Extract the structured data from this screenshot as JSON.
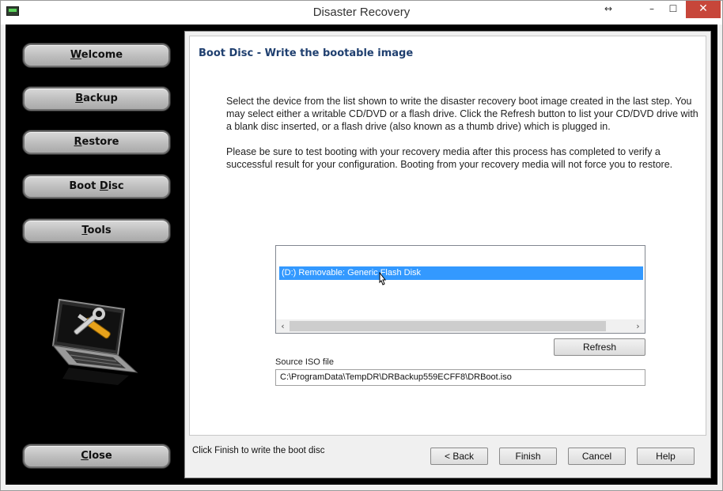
{
  "window": {
    "title": "Disaster Recovery",
    "controls": {
      "resize": "↔",
      "minimize": "–",
      "maximize": "☐",
      "close": "✕"
    }
  },
  "sidebar": {
    "items": [
      {
        "pre": "",
        "accel": "W",
        "post": "elcome"
      },
      {
        "pre": "",
        "accel": "B",
        "post": "ackup"
      },
      {
        "pre": "",
        "accel": "R",
        "post": "estore"
      },
      {
        "pre": "Boot ",
        "accel": "D",
        "post": "isc"
      },
      {
        "pre": "",
        "accel": "T",
        "post": "ools"
      }
    ],
    "close": {
      "pre": "",
      "accel": "C",
      "post": "lose"
    }
  },
  "page": {
    "title": "Boot Disc - Write the bootable image",
    "desc1": "Select the device from the list shown to write the disaster recovery boot image created in the last step. You may select either a writable CD/DVD or a flash drive. Click the Refresh button to list your CD/DVD drive with a blank disc inserted, or a flash drive (also known as a thumb drive) which is plugged in.",
    "desc2": "Please be sure to test booting with your recovery media after this process has completed to verify a successful result for your configuration. Booting from your recovery media will not force you to restore."
  },
  "devices": {
    "items": [
      "(D:) Removable: Generic Flash Disk"
    ],
    "selected_index": 0,
    "scroll_left": "‹",
    "scroll_right": "›"
  },
  "refresh_label": "Refresh",
  "iso": {
    "label": "Source ISO file",
    "value": "C:\\ProgramData\\TempDR\\DRBackup559ECFF8\\DRBoot.iso"
  },
  "footer": {
    "status": "Click Finish to write the boot disc",
    "back": "< Back",
    "finish": "Finish",
    "cancel": "Cancel",
    "help": "Help"
  },
  "colors": {
    "accent_title": "#1f3f6f",
    "selection": "#3399ff",
    "close_button": "#c7463a"
  }
}
